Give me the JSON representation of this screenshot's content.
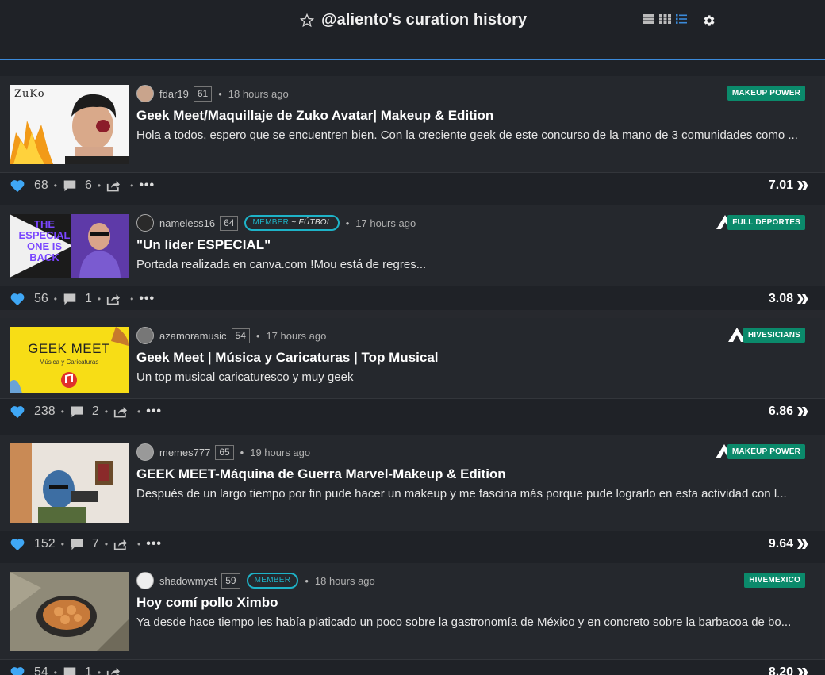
{
  "header": {
    "title": "@aliento's curation history",
    "icons": [
      "star-icon",
      "list-view-icon",
      "grid-view-icon",
      "compact-view-icon",
      "gear-icon"
    ]
  },
  "posts": [
    {
      "author": "fdar19",
      "reputation": "61",
      "member_badge": "",
      "member_community": "",
      "time_ago": "18 hours ago",
      "community": "MAKEUP POWER",
      "title": "Geek Meet/Maquillaje de Zuko Avatar| Makeup & Edition",
      "summary": "Hola a todos, espero que se encuentren bien. Con la creciente geek de este concurso de la mano de 3 comunidades como ...",
      "thumb_caption": "ZuKo",
      "votes": "68",
      "comments": "6",
      "payout": "7.01"
    },
    {
      "author": "nameless16",
      "reputation": "64",
      "member_badge": "MEMBER",
      "member_community": "~ FÚTBOL",
      "time_ago": "17 hours ago",
      "community": "FULL DEPORTES",
      "title": "\"Un líder ESPECIAL\"",
      "summary": "Portada realizada en canva.com !Mou está de regres...",
      "thumb_caption": "THE ESPECIAL ONE IS BACK",
      "votes": "56",
      "comments": "1",
      "payout": "3.08"
    },
    {
      "author": "azamoramusic",
      "reputation": "54",
      "member_badge": "",
      "member_community": "",
      "time_ago": "17 hours ago",
      "community": "HIVESICIANS",
      "title": "Geek Meet | Música y Caricaturas | Top Musical",
      "summary": "Un top musical caricaturesco y muy geek",
      "thumb_caption": "GEEK MEET",
      "thumb_sub": "Música y Caricaturas",
      "votes": "238",
      "comments": "2",
      "payout": "6.86"
    },
    {
      "author": "memes777",
      "reputation": "65",
      "member_badge": "",
      "member_community": "",
      "time_ago": "19 hours ago",
      "community": "MAKEUP POWER",
      "title": "GEEK MEET-Máquina de Guerra Marvel-Makeup & Edition",
      "summary": "Después de un largo tiempo por fin pude hacer un makeup y me fascina más porque pude lograrlo en esta actividad con l...",
      "votes": "152",
      "comments": "7",
      "payout": "9.64"
    },
    {
      "author": "shadowmyst",
      "reputation": "59",
      "member_badge": "MEMBER",
      "member_community": "",
      "time_ago": "18 hours ago",
      "community": "HIVEMEXICO",
      "title": "Hoy comí pollo Ximbo",
      "summary": "Ya desde hace tiempo les había platicado un poco sobre la gastronomía de México y en concreto sobre la barbacoa de bo...",
      "votes": "54",
      "comments": "1",
      "payout": "8.20"
    }
  ],
  "colors": {
    "background": "#1f2227",
    "card": "#25282d",
    "accent_blue": "#3b8ad9",
    "heart": "#3fa7f5",
    "community_badge": "#0b8a6b",
    "member_badge": "#1eb3c8"
  }
}
